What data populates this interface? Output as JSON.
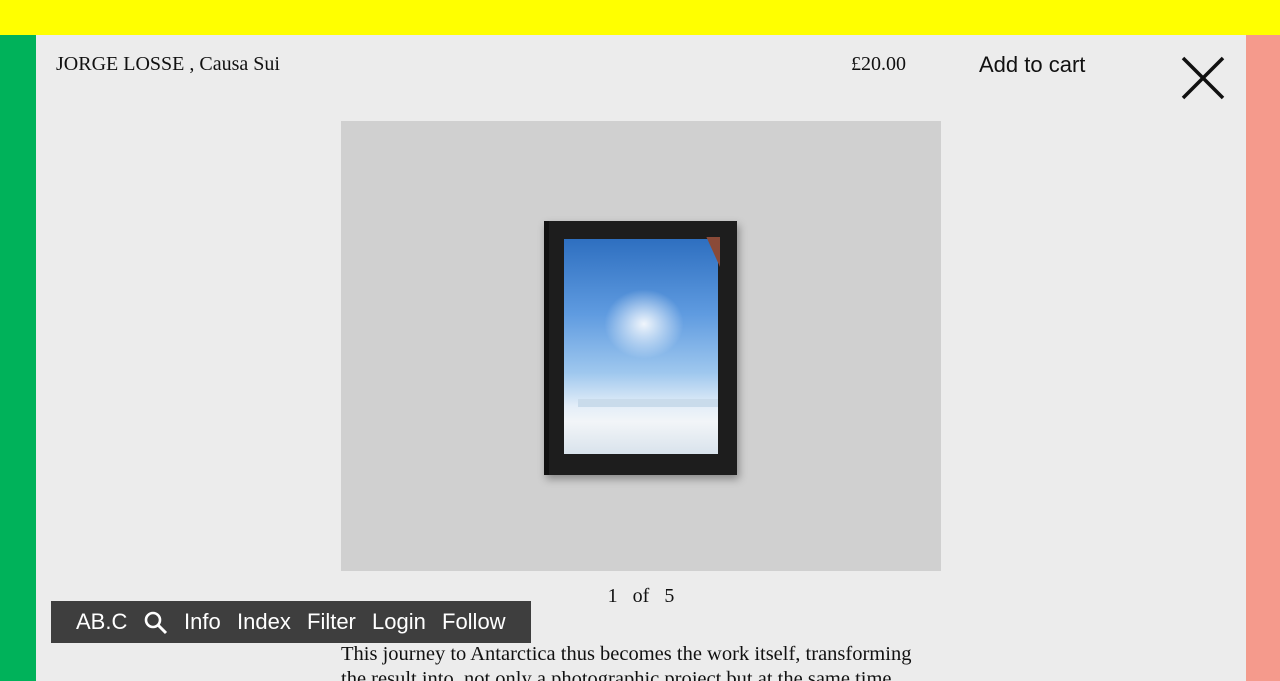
{
  "product": {
    "title": "JORGE LOSSE , Causa Sui",
    "price": "£20.00",
    "add_to_cart": "Add to cart"
  },
  "icons": {
    "close": "close-icon",
    "search": "search-icon"
  },
  "gallery": {
    "current": "1",
    "of": "of",
    "total": "5"
  },
  "description": "This journey to Antarctica thus becomes the work itself, transforming the result into, not only a photographic project but at the same time",
  "nav": {
    "home": "AB.C",
    "info": "Info",
    "index": "Index",
    "filter": "Filter",
    "login": "Login",
    "follow": "Follow"
  },
  "colors": {
    "top_bar": "#ffff00",
    "left_strip": "#00b25a",
    "right_strip": "#f59a8c",
    "panel": "#ececec",
    "nav_bg": "#3e3e3e"
  }
}
